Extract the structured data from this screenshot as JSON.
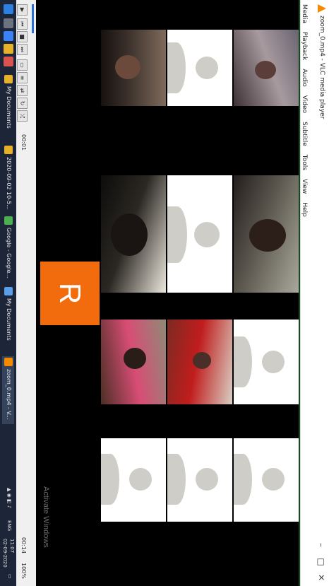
{
  "window": {
    "title": "zoom_0.mp4 - VLC media player",
    "minimize": "–",
    "maximize": "□",
    "close": "✕"
  },
  "menu": [
    "Media",
    "Playback",
    "Audio",
    "Video",
    "Subtitle",
    "Tools",
    "View",
    "Help"
  ],
  "video": {
    "participant_initial": "R",
    "watermark": "Activate Windows"
  },
  "controls": {
    "time_elapsed": "00:01",
    "time_total": "00:14",
    "volume": "100%",
    "buttons": [
      "▶",
      "⏮",
      "■",
      "⏭",
      "▭",
      "≡",
      "⇄",
      "↻",
      "⤮"
    ],
    "progress_fraction": 0.05
  },
  "taskbar": {
    "items": [
      {
        "label": "My Documents",
        "color": "#e7b12a"
      },
      {
        "label": "2020-09-02 10-5...",
        "color": "#e7b12a"
      },
      {
        "label": "Google - Google...",
        "color": "#4caf50"
      },
      {
        "label": "My Documents",
        "color": "#5aa0e8"
      },
      {
        "label": "zoom_0.mp4 - V...",
        "color": "#f48a00"
      }
    ],
    "tray_text": "ENG",
    "clock_time": "11:07",
    "clock_date": "02-09-2020"
  },
  "colors": {
    "accent_orange": "#f26b0c",
    "vlc_orange": "#f48a00",
    "taskbar": "#1c2638"
  }
}
